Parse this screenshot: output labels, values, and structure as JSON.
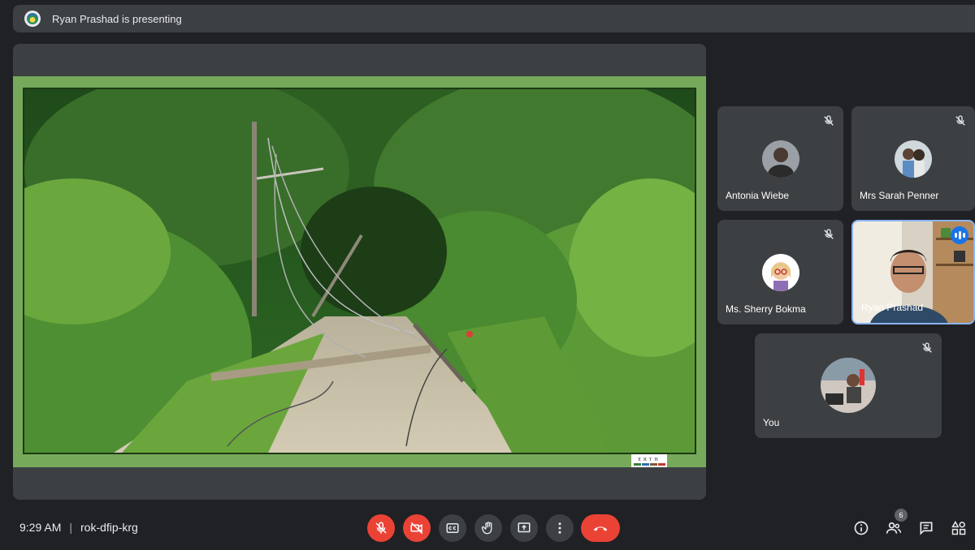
{
  "banner": {
    "text": "Ryan Prashad is presenting"
  },
  "presentation": {
    "logo_text": "ERTH",
    "logo_colors": [
      "#3a7d3a",
      "#2c6fb6",
      "#7a5a3a",
      "#c0392b"
    ]
  },
  "participants": [
    {
      "name": "Antonia Wiebe",
      "muted": true
    },
    {
      "name": "Mrs Sarah Penner",
      "muted": true
    },
    {
      "name": "Ms. Sherry Bokma",
      "muted": true
    },
    {
      "name": "Ryan Prashad",
      "muted": false,
      "speaking": true
    },
    {
      "name": "You",
      "muted": true
    }
  ],
  "bottom": {
    "time": "9:29 AM",
    "separator": "|",
    "meeting_code": "rok-dfip-krg",
    "participant_count": "6"
  },
  "controls": [
    {
      "icon": "mic-off-icon",
      "state": "off"
    },
    {
      "icon": "camera-off-icon",
      "state": "off"
    },
    {
      "icon": "captions-icon"
    },
    {
      "icon": "raise-hand-icon"
    },
    {
      "icon": "present-screen-icon"
    },
    {
      "icon": "more-options-icon"
    },
    {
      "icon": "leave-call-icon"
    }
  ],
  "right_controls": [
    "info-icon",
    "people-icon",
    "chat-icon",
    "activities-icon"
  ],
  "colors": {
    "accent": "#8ab4f8",
    "danger": "#ea4335",
    "surface": "#3c4043",
    "background": "#202124",
    "slide_border": "#77a95b"
  }
}
